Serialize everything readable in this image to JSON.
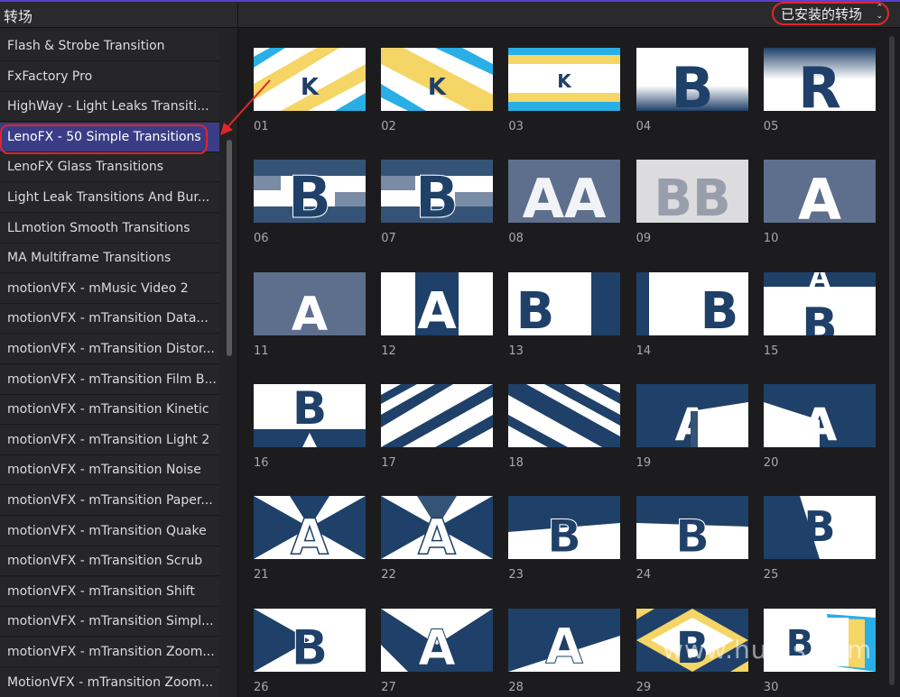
{
  "header": {
    "title": "转场",
    "popup_label": "已安装的转场",
    "chevron": "⌃⌄"
  },
  "sidebar": {
    "items": [
      "Flash & Strobe Transition",
      "FxFactory Pro",
      "HighWay - Light Leaks Transiti...",
      "LenoFX - 50 Simple Transitions",
      "LenoFX Glass Transitions",
      "Light Leak Transitions And Bur...",
      "LLmotion Smooth Transitions",
      "MA Multiframe Transitions",
      "motionVFX - mMusic Video 2",
      "motionVFX - mTransition Data...",
      "motionVFX - mTransition Distor...",
      "motionVFX - mTransition Film B...",
      "motionVFX - mTransition Kinetic",
      "motionVFX - mTransition Light 2",
      "motionVFX - mTransition Noise",
      "motionVFX - mTransition Paper...",
      "motionVFX - mTransition Quake",
      "motionVFX - mTransition Scrub",
      "motionVFX - mTransition Shift",
      "motionVFX - mTransition Simpl...",
      "motionVFX - mTransition Zoom...",
      "MotionVFX - mTransition Zoom..."
    ],
    "selected_index": 3
  },
  "thumbnails": [
    {
      "label": "01",
      "letter": "K"
    },
    {
      "label": "02",
      "letter": "K"
    },
    {
      "label": "03",
      "letter": "K"
    },
    {
      "label": "04",
      "letter": "B"
    },
    {
      "label": "05",
      "letter": "R"
    },
    {
      "label": "06",
      "letter": "B"
    },
    {
      "label": "07",
      "letter": "B"
    },
    {
      "label": "08",
      "letter": "AA"
    },
    {
      "label": "09",
      "letter": "BB"
    },
    {
      "label": "10",
      "letter": "A"
    },
    {
      "label": "11",
      "letter": "A"
    },
    {
      "label": "12",
      "letter": "A"
    },
    {
      "label": "13",
      "letter": "B"
    },
    {
      "label": "14",
      "letter": "B"
    },
    {
      "label": "15",
      "letter": "B"
    },
    {
      "label": "16",
      "letter": "B"
    },
    {
      "label": "17",
      "letter": ""
    },
    {
      "label": "18",
      "letter": ""
    },
    {
      "label": "19",
      "letter": "A"
    },
    {
      "label": "20",
      "letter": "A"
    },
    {
      "label": "21",
      "letter": "A"
    },
    {
      "label": "22",
      "letter": "A"
    },
    {
      "label": "23",
      "letter": "B"
    },
    {
      "label": "24",
      "letter": "B"
    },
    {
      "label": "25",
      "letter": "B"
    },
    {
      "label": "26",
      "letter": "B"
    },
    {
      "label": "27",
      "letter": "A"
    },
    {
      "label": "28",
      "letter": "A"
    },
    {
      "label": "29",
      "letter": "B"
    },
    {
      "label": "30",
      "letter": "B"
    }
  ],
  "watermark": "www.hunls.com",
  "colors": {
    "navy": "#1f4068",
    "yellow": "#f5d565",
    "cyan": "#29aee6",
    "selection": "#3a3d86",
    "highlight_red": "#e0262a"
  }
}
